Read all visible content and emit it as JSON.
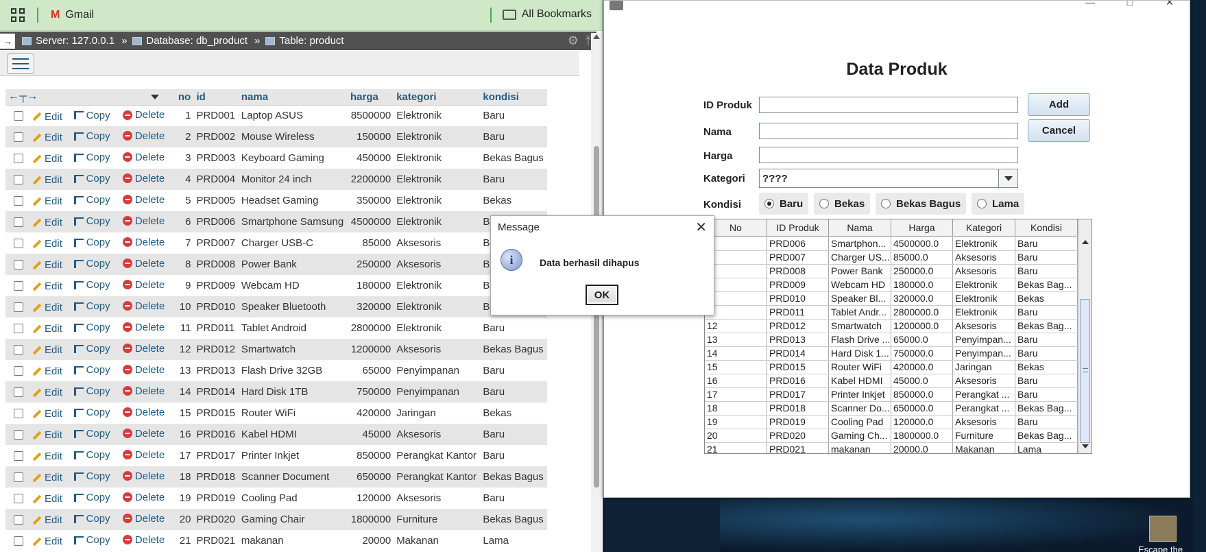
{
  "browser": {
    "bookmarks": {
      "gmail": "Gmail",
      "all_bookmarks": "All Bookmarks"
    },
    "breadcrumb": {
      "server": "Server: 127.0.0.1",
      "database": "Database: db_product",
      "table": "Table: product",
      "separator": "»"
    },
    "table": {
      "headers": [
        "no",
        "id",
        "nama",
        "harga",
        "kategori",
        "kondisi"
      ],
      "actions": {
        "edit": "Edit",
        "copy": "Copy",
        "delete": "Delete"
      },
      "rows": [
        [
          "1",
          "PRD001",
          "Laptop ASUS",
          "8500000",
          "Elektronik",
          "Baru"
        ],
        [
          "2",
          "PRD002",
          "Mouse Wireless",
          "150000",
          "Elektronik",
          "Baru"
        ],
        [
          "3",
          "PRD003",
          "Keyboard Gaming",
          "450000",
          "Elektronik",
          "Bekas Bagus"
        ],
        [
          "4",
          "PRD004",
          "Monitor 24 inch",
          "2200000",
          "Elektronik",
          "Baru"
        ],
        [
          "5",
          "PRD005",
          "Headset Gaming",
          "350000",
          "Elektronik",
          "Bekas"
        ],
        [
          "6",
          "PRD006",
          "Smartphone Samsung",
          "4500000",
          "Elektronik",
          "B"
        ],
        [
          "7",
          "PRD007",
          "Charger USB-C",
          "85000",
          "Aksesoris",
          "B"
        ],
        [
          "8",
          "PRD008",
          "Power Bank",
          "250000",
          "Aksesoris",
          "B"
        ],
        [
          "9",
          "PRD009",
          "Webcam HD",
          "180000",
          "Elektronik",
          "B"
        ],
        [
          "10",
          "PRD010",
          "Speaker Bluetooth",
          "320000",
          "Elektronik",
          "B"
        ],
        [
          "11",
          "PRD011",
          "Tablet Android",
          "2800000",
          "Elektronik",
          "Baru"
        ],
        [
          "12",
          "PRD012",
          "Smartwatch",
          "1200000",
          "Aksesoris",
          "Bekas Bagus"
        ],
        [
          "13",
          "PRD013",
          "Flash Drive 32GB",
          "65000",
          "Penyimpanan",
          "Baru"
        ],
        [
          "14",
          "PRD014",
          "Hard Disk 1TB",
          "750000",
          "Penyimpanan",
          "Baru"
        ],
        [
          "15",
          "PRD015",
          "Router WiFi",
          "420000",
          "Jaringan",
          "Bekas"
        ],
        [
          "16",
          "PRD016",
          "Kabel HDMI",
          "45000",
          "Aksesoris",
          "Baru"
        ],
        [
          "17",
          "PRD017",
          "Printer Inkjet",
          "850000",
          "Perangkat Kantor",
          "Baru"
        ],
        [
          "18",
          "PRD018",
          "Scanner Document",
          "650000",
          "Perangkat Kantor",
          "Bekas Bagus"
        ],
        [
          "19",
          "PRD019",
          "Cooling Pad",
          "120000",
          "Aksesoris",
          "Baru"
        ],
        [
          "20",
          "PRD020",
          "Gaming Chair",
          "1800000",
          "Furniture",
          "Bekas Bagus"
        ],
        [
          "21",
          "PRD021",
          "makanan",
          "20000",
          "Makanan",
          "Lama"
        ]
      ]
    }
  },
  "java_app": {
    "title": "Data Produk",
    "labels": {
      "id_produk": "ID Produk",
      "nama": "Nama",
      "harga": "Harga",
      "kategori": "Kategori",
      "kondisi": "Kondisi"
    },
    "buttons": {
      "add": "Add",
      "cancel": "Cancel"
    },
    "kategori_value": "????",
    "kondisi_options": [
      "Baru",
      "Bekas",
      "Bekas Bagus",
      "Lama"
    ],
    "kondisi_selected": "Baru",
    "table_headers": [
      "No",
      "ID Produk",
      "Nama",
      "Harga",
      "Kategori",
      "Kondisi"
    ],
    "table_rows": [
      [
        "",
        "PRD006",
        "Smartphon...",
        "4500000.0",
        "Elektronik",
        "Baru"
      ],
      [
        "",
        "PRD007",
        "Charger US...",
        "85000.0",
        "Aksesoris",
        "Baru"
      ],
      [
        "",
        "PRD008",
        "Power Bank",
        "250000.0",
        "Aksesoris",
        "Baru"
      ],
      [
        "",
        "PRD009",
        "Webcam HD",
        "180000.0",
        "Elektronik",
        "Bekas Bag..."
      ],
      [
        "0",
        "PRD010",
        "Speaker Bl...",
        "320000.0",
        "Elektronik",
        "Bekas"
      ],
      [
        "",
        "PRD011",
        "Tablet Andr...",
        "2800000.0",
        "Elektronik",
        "Baru"
      ],
      [
        "12",
        "PRD012",
        "Smartwatch",
        "1200000.0",
        "Aksesoris",
        "Bekas Bag..."
      ],
      [
        "13",
        "PRD013",
        "Flash Drive ...",
        "65000.0",
        "Penyimpan...",
        "Baru"
      ],
      [
        "14",
        "PRD014",
        "Hard Disk 1...",
        "750000.0",
        "Penyimpan...",
        "Baru"
      ],
      [
        "15",
        "PRD015",
        "Router WiFi",
        "420000.0",
        "Jaringan",
        "Bekas"
      ],
      [
        "16",
        "PRD016",
        "Kabel HDMI",
        "45000.0",
        "Aksesoris",
        "Baru"
      ],
      [
        "17",
        "PRD017",
        "Printer Inkjet",
        "850000.0",
        "Perangkat ...",
        "Baru"
      ],
      [
        "18",
        "PRD018",
        "Scanner Do...",
        "650000.0",
        "Perangkat ...",
        "Bekas Bag..."
      ],
      [
        "19",
        "PRD019",
        "Cooling Pad",
        "120000.0",
        "Aksesoris",
        "Baru"
      ],
      [
        "20",
        "PRD020",
        "Gaming Ch...",
        "1800000.0",
        "Furniture",
        "Bekas Bag..."
      ],
      [
        "21",
        "PRD021",
        "makanan",
        "20000.0",
        "Makanan",
        "Lama"
      ]
    ]
  },
  "dialog": {
    "title": "Message",
    "message": "Data berhasil dihapus",
    "ok": "OK",
    "close": "✕",
    "icon_glyph": "i"
  },
  "desktop": {
    "shortcut_label": "Escape the"
  }
}
